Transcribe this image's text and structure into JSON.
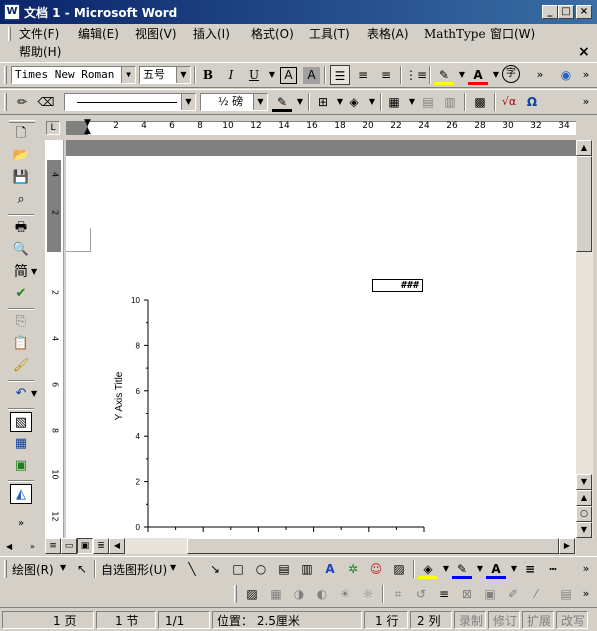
{
  "window": {
    "title": "文档 1 - Microsoft Word",
    "app_icon": "W"
  },
  "menu": {
    "items": [
      "文件(F)",
      "编辑(E)",
      "视图(V)",
      "插入(I)",
      "格式(O)",
      "工具(T)",
      "表格(A)",
      "MathType",
      "窗口(W)",
      "帮助(H)"
    ]
  },
  "format_toolbar": {
    "font_name": "Times New Roman",
    "font_size": "五号",
    "bold": "B",
    "italic": "I",
    "underline": "U",
    "char_border": "A",
    "char_shading": "A"
  },
  "drawing_line_toolbar": {
    "line_weight": "½ 磅"
  },
  "ruler": {
    "h_ticks": [
      "2",
      "4",
      "6",
      "8",
      "10",
      "12",
      "14",
      "16",
      "18",
      "20",
      "22",
      "24",
      "26",
      "28",
      "30",
      "32",
      "34"
    ],
    "v_ticks": [
      "4",
      "2",
      "2",
      "4",
      "6",
      "8",
      "10",
      "12"
    ]
  },
  "document": {
    "cell_text": "###",
    "chart_data": {
      "type": "scatter",
      "ylabel": "Y Axis Title",
      "xlabel": "",
      "ylim": [
        0,
        10
      ],
      "y_ticks": [
        "0",
        "2",
        "4",
        "6",
        "8",
        "10"
      ],
      "series": []
    }
  },
  "drawbar": {
    "draw_label": "绘图(R)",
    "autoshapes_label": "自选图形(U)"
  },
  "statusbar": {
    "page": "1 页",
    "section": "1 节",
    "pages": "1/1",
    "position": "位置： 2.5厘米",
    "line": "1 行",
    "column": "2 列",
    "rec": "录制",
    "trk": "修订",
    "ext": "扩展",
    "ovr": "改写"
  }
}
